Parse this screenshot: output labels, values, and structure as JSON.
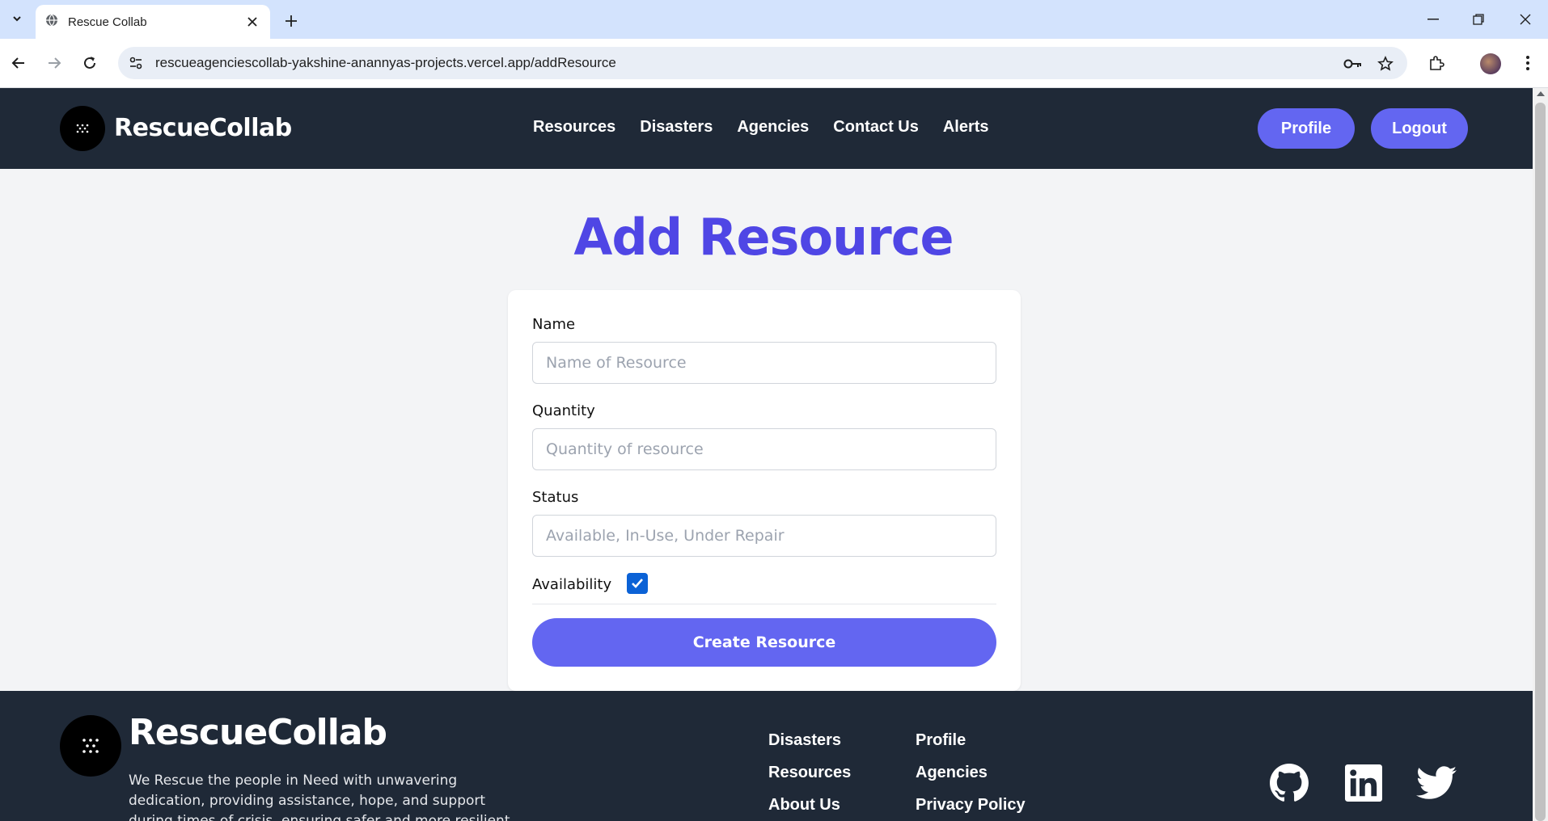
{
  "browser": {
    "tab_title": "Rescue Collab",
    "url": "rescueagenciescollab-yakshine-anannyas-projects.vercel.app/addResource"
  },
  "header": {
    "brand": "RescueCollab",
    "nav": [
      "Resources",
      "Disasters",
      "Agencies",
      "Contact Us",
      "Alerts"
    ],
    "profile_label": "Profile",
    "logout_label": "Logout"
  },
  "page": {
    "title": "Add Resource"
  },
  "form": {
    "name_label": "Name",
    "name_placeholder": "Name of Resource",
    "name_value": "",
    "quantity_label": "Quantity",
    "quantity_placeholder": "Quantity of resource",
    "quantity_value": "",
    "status_label": "Status",
    "status_placeholder": "Available, In-Use, Under Repair",
    "status_value": "",
    "availability_label": "Availability",
    "availability_checked": true,
    "submit_label": "Create Resource"
  },
  "footer": {
    "brand": "RescueCollab",
    "description": "We Rescue the people in Need with unwavering dedication, providing assistance, hope, and support during times of crisis, ensuring safer and more resilient world for all.",
    "links_col1": [
      "Disasters",
      "Resources",
      "About Us"
    ],
    "links_col2": [
      "Profile",
      "Agencies",
      "Privacy Policy"
    ],
    "social_icons": [
      "github-icon",
      "linkedin-icon",
      "twitter-icon"
    ]
  },
  "colors": {
    "header_bg": "#1f2937",
    "accent": "#6366f1",
    "title": "#4f46e5",
    "page_bg": "#f3f4f6"
  }
}
